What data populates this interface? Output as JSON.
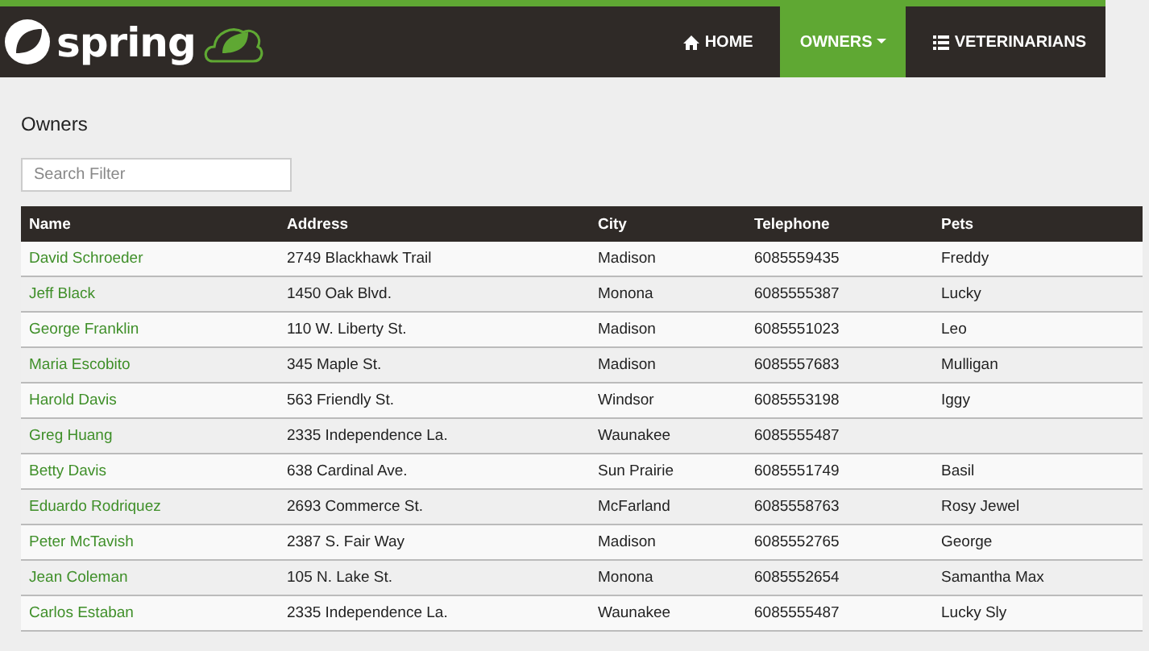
{
  "navbar": {
    "brand": "spring",
    "items": [
      {
        "label": "HOME",
        "selected": false,
        "dropdown": false
      },
      {
        "label": "OWNERS",
        "selected": true,
        "dropdown": true
      },
      {
        "label": "VETERINARIANS",
        "selected": false,
        "dropdown": false
      }
    ]
  },
  "page": {
    "title": "Owners",
    "search": {
      "placeholder": "Search Filter"
    }
  },
  "table": {
    "columns": [
      "Name",
      "Address",
      "City",
      "Telephone",
      "Pets"
    ],
    "rows": [
      {
        "name": "David Schroeder",
        "address": "2749 Blackhawk Trail",
        "city": "Madison",
        "telephone": "6085559435",
        "pets": "Freddy"
      },
      {
        "name": "Jeff Black",
        "address": "1450 Oak Blvd.",
        "city": "Monona",
        "telephone": "6085555387",
        "pets": "Lucky"
      },
      {
        "name": "George Franklin",
        "address": "110 W. Liberty St.",
        "city": "Madison",
        "telephone": "6085551023",
        "pets": "Leo"
      },
      {
        "name": "Maria Escobito",
        "address": "345 Maple St.",
        "city": "Madison",
        "telephone": "6085557683",
        "pets": "Mulligan"
      },
      {
        "name": "Harold Davis",
        "address": "563 Friendly St.",
        "city": "Windsor",
        "telephone": "6085553198",
        "pets": "Iggy"
      },
      {
        "name": "Greg Huang",
        "address": "2335 Independence La.",
        "city": "Waunakee",
        "telephone": "6085555487"
      },
      {
        "name": "Betty Davis",
        "address": "638 Cardinal Ave.",
        "city": "Sun Prairie",
        "telephone": "6085551749",
        "pets": "Basil"
      },
      {
        "name": "Eduardo Rodriquez",
        "address": "2693 Commerce St.",
        "city": "McFarland",
        "telephone": "6085558763",
        "pets": "Rosy Jewel"
      },
      {
        "name": "Peter McTavish",
        "address": "2387 S. Fair Way",
        "city": "Madison",
        "telephone": "6085552765",
        "pets": "George"
      },
      {
        "name": "Jean Coleman",
        "address": "105 N. Lake St.",
        "city": "Monona",
        "telephone": "6085552654",
        "pets": "Samantha Max"
      },
      {
        "name": "Carlos Estaban",
        "address": "2335 Independence La.",
        "city": "Waunakee",
        "telephone": "6085555487",
        "pets": "Lucky Sly"
      }
    ]
  }
}
